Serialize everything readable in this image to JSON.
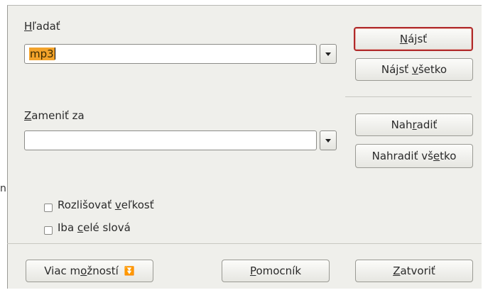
{
  "stray_text": "n",
  "find": {
    "label": "Hľadať",
    "value": "mp3"
  },
  "replace": {
    "label": "Zameniť za",
    "value": ""
  },
  "buttons": {
    "find": "Nájsť",
    "find_all": "Nájsť všetko",
    "replace": "Nahradiť",
    "replace_all": "Nahradiť všetko",
    "more_options": "Viac možností",
    "help": "Pomocník",
    "close": "Zatvoriť"
  },
  "options": {
    "match_case": {
      "label": "Rozlišovať veľkosť",
      "checked": false
    },
    "whole_words": {
      "label": "Iba celé slová",
      "checked": false
    }
  },
  "colors": {
    "dialog_bg": "#efefeb",
    "selection_highlight": "#f3a32b",
    "default_button_border": "#b02a2a"
  }
}
